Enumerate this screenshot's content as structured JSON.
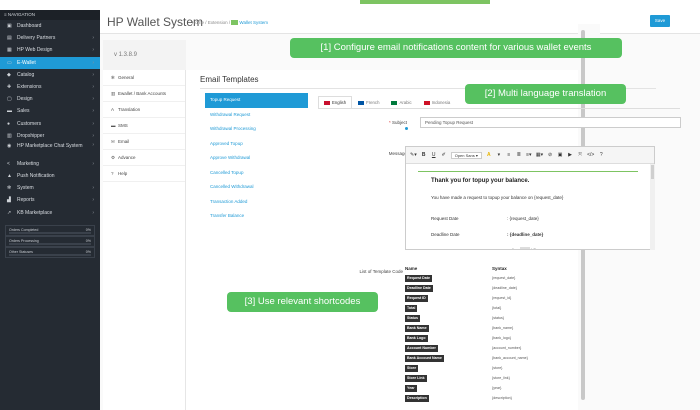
{
  "sidebar": {
    "nav_label": "NAVIGATION",
    "items": [
      {
        "icon": "dashboard-icon",
        "glyph": "▣",
        "label": "Dashboard",
        "arrow": ""
      },
      {
        "icon": "truck-icon",
        "glyph": "▤",
        "label": "Delivery Partners",
        "arrow": "›"
      },
      {
        "icon": "layout-icon",
        "glyph": "▦",
        "label": "HP Web Design",
        "arrow": "›"
      },
      {
        "icon": "wallet-icon",
        "glyph": "▭",
        "label": "E-Wallet",
        "arrow": "›",
        "active": true
      },
      {
        "icon": "tag-icon",
        "glyph": "◆",
        "label": "Catalog",
        "arrow": "›"
      },
      {
        "icon": "puzzle-icon",
        "glyph": "✚",
        "label": "Extensions",
        "arrow": "›"
      },
      {
        "icon": "monitor-icon",
        "glyph": "▢",
        "label": "Design",
        "arrow": "›"
      },
      {
        "icon": "cart-icon",
        "glyph": "▬",
        "label": "Sales",
        "arrow": "›"
      },
      {
        "icon": "user-icon",
        "glyph": "●",
        "label": "Customers",
        "arrow": "›"
      },
      {
        "icon": "dropshipper-icon",
        "glyph": "▥",
        "label": "Dropshipper",
        "arrow": "›"
      },
      {
        "icon": "chat-icon",
        "glyph": "◉",
        "label": "HP Marketplace Chat System",
        "arrow": "›",
        "two": true
      },
      {
        "icon": "share-icon",
        "glyph": "<",
        "label": "Marketing",
        "arrow": "›"
      },
      {
        "icon": "bell-icon",
        "glyph": "▲",
        "label": "Push Notification",
        "arrow": ""
      },
      {
        "icon": "gear-icon",
        "glyph": "✻",
        "label": "System",
        "arrow": "›"
      },
      {
        "icon": "chart-icon",
        "glyph": "▟",
        "label": "Reports",
        "arrow": "›"
      },
      {
        "icon": "market-icon",
        "glyph": "↗",
        "label": "KB Marketplace",
        "arrow": "›"
      }
    ],
    "stats": [
      {
        "label": "Orders Completed",
        "pct": "0%"
      },
      {
        "label": "Orders Processing",
        "pct": "0%"
      },
      {
        "label": "Other Statuses",
        "pct": "0%"
      }
    ]
  },
  "header": {
    "title": "HP Wallet System",
    "crumb_home": "Home",
    "crumb_sep": "/",
    "crumb_ext": "Extension",
    "crumb_current": "Wallet System",
    "save_label": "Save"
  },
  "version": "v 1.3.8.9",
  "settings_nav": [
    {
      "icon": "gear-icon",
      "glyph": "✻",
      "label": "General"
    },
    {
      "icon": "bank-icon",
      "glyph": "▥",
      "label": "Ewallet / Bank Accounts"
    },
    {
      "icon": "translate-icon",
      "glyph": "A",
      "label": "Translation"
    },
    {
      "icon": "sms-icon",
      "glyph": "▬",
      "label": "SMS"
    },
    {
      "icon": "email-icon",
      "glyph": "✉",
      "label": "Email"
    },
    {
      "icon": "advance-icon",
      "glyph": "⚙",
      "label": "Advance"
    },
    {
      "icon": "help-icon",
      "glyph": "?",
      "label": "Help"
    }
  ],
  "email": {
    "section_title": "Email Templates",
    "events": [
      "Topup Request",
      "Withdrawal Request",
      "Withdrawal Processing",
      "Approved Topup",
      "Approve Withdrawal",
      "Cancelled Topup",
      "Cancelled Withdrawal",
      "Transaction Added",
      "Transfer Balance"
    ],
    "languages": [
      {
        "label": "English",
        "flag": "#c8102e"
      },
      {
        "label": "French",
        "flag": "#0055a4"
      },
      {
        "label": "Arabic",
        "flag": "#007a3d"
      },
      {
        "label": "Indonesia",
        "flag": "#ce1126"
      }
    ],
    "subject_label": "Subject",
    "subject_required": "*",
    "subject_value": "Pending Topup Request",
    "message_label": "Message",
    "toolbar": {
      "magic": "✎▾",
      "bold": "B",
      "underline": "U",
      "eraser": "✐",
      "font": "Open Sans ▾",
      "color": "A",
      "size": "▾",
      "ul": "≡",
      "ol": "≣",
      "align": "≡▾",
      "table": "▦▾",
      "link": "⊘",
      "image": "▣",
      "video": "▶",
      "full": "⤧",
      "code": "</>",
      "help": "?"
    },
    "body": {
      "heading": "Thank you for topup your balance.",
      "para": "You have made a request to topup your balance on {request_date}",
      "rows": [
        {
          "k": "Request Date",
          "v": ": {request_date}",
          "bold": false
        },
        {
          "k": "Deadline Date",
          "v": ": {deadline_date}",
          "bold": true
        },
        {
          "k": "ID Request",
          "v": ": #{request_id}",
          "bold": false
        }
      ]
    },
    "codes_label": "List of Template Code",
    "col_name": "Name",
    "col_syntax": "Syntax",
    "codes": [
      {
        "name": "Request Date",
        "syntax": "{request_date}"
      },
      {
        "name": "Deadline Date",
        "syntax": "{deadline_date}"
      },
      {
        "name": "Request ID",
        "syntax": "{request_id}"
      },
      {
        "name": "Total",
        "syntax": "{total}"
      },
      {
        "name": "Status",
        "syntax": "{status}"
      },
      {
        "name": "Bank Name",
        "syntax": "{bank_name}"
      },
      {
        "name": "Bank Logo",
        "syntax": "{bank_logo}"
      },
      {
        "name": "Account Number",
        "syntax": "{account_number}"
      },
      {
        "name": "Bank Account Name",
        "syntax": "{bank_account_name}"
      },
      {
        "name": "Store",
        "syntax": "{store}"
      },
      {
        "name": "Store Link",
        "syntax": "{store_link}"
      },
      {
        "name": "Year",
        "syntax": "{year}"
      },
      {
        "name": "Description",
        "syntax": "{description}"
      }
    ]
  },
  "callouts": {
    "one": "[1] Configure email notifications content for various wallet events",
    "two": "[2] Multi language translation",
    "three": "[3] Use relevant shortcodes"
  },
  "colors": {
    "accent": "#1f9ad6",
    "callout": "#56c160",
    "sidebar": "#252b33"
  }
}
